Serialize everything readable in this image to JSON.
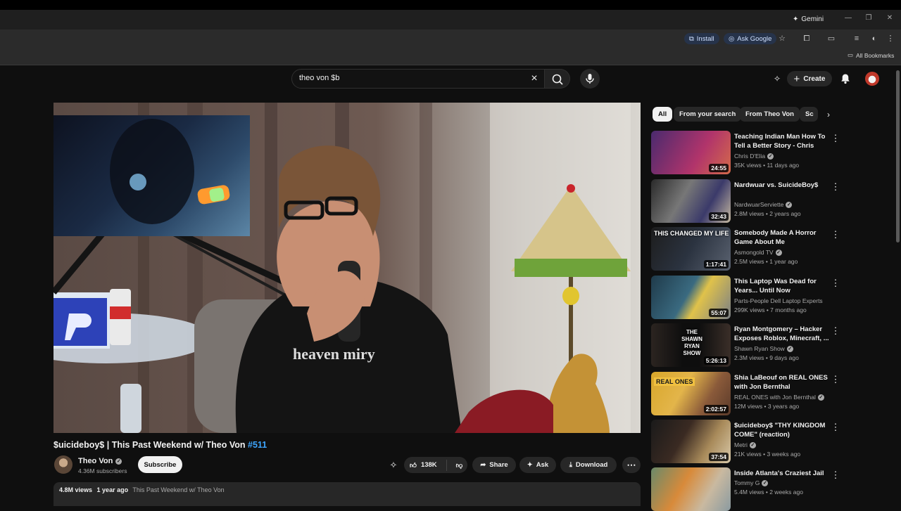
{
  "browser": {
    "gemini_label": "Gemini",
    "install_label": "Install",
    "ask_google_label": "Ask Google",
    "all_bookmarks_label": "All Bookmarks"
  },
  "youtube": {
    "search": {
      "value": "theo von $b"
    },
    "create_label": "Create"
  },
  "video": {
    "title_main": "$uicideboy$ | This Past Weekend w/ Theo Von",
    "title_tag": "#511",
    "channel": "Theo Von",
    "subscribers": "4.36M subscribers",
    "subscribe_label": "Subscribe",
    "likes": "138K",
    "share_label": "Share",
    "ask_label": "Ask",
    "download_label": "Download",
    "views": "4.8M views",
    "age": "1 year ago",
    "description_preview": "This Past Weekend w/ Theo Von"
  },
  "chips": [
    "All",
    "From your search",
    "From Theo Von",
    "Sc"
  ],
  "recommendations": [
    {
      "title": "Teaching Indian Man How To Tell a Better Story - Chris D'Eli...",
      "channel": "Chris D'Elia",
      "verified": true,
      "meta": "35K views • 11 days ago",
      "duration": "24:55",
      "thumb_text": ""
    },
    {
      "title": "Nardwuar vs. SuicideBoy$",
      "channel": "NardwuarServiette",
      "verified": true,
      "meta": "2.8M views • 2 years ago",
      "duration": "32:43",
      "thumb_text": ""
    },
    {
      "title": "Somebody Made A Horror Game About Me",
      "channel": "Asmongold TV",
      "verified": true,
      "meta": "2.5M views • 1 year ago",
      "duration": "1:17:41",
      "thumb_text": "THIS CHANGED MY LIFE"
    },
    {
      "title": "This Laptop Was Dead for Years... Until Now",
      "channel": "Parts-People Dell Laptop Experts",
      "verified": false,
      "meta": "299K views • 7 months ago",
      "duration": "55:07",
      "thumb_text": ""
    },
    {
      "title": "Ryan Montgomery – Hacker Exposes Roblox, Minecraft, ...",
      "channel": "Shawn Ryan Show",
      "verified": true,
      "meta": "2.3M views • 9 days ago",
      "duration": "5:26:13",
      "thumb_text": "THE SHAWN RYAN SHOW"
    },
    {
      "title": "Shia LaBeouf on REAL ONES with Jon Bernthal",
      "channel": "REAL ONES with Jon Bernthal",
      "verified": true,
      "meta": "12M views • 3 years ago",
      "duration": "2:02:57",
      "thumb_text": "REAL ONES"
    },
    {
      "title": "$uicideboy$ \"THY KINGDOM COME\" (reaction)",
      "channel": "Metri",
      "verified": true,
      "meta": "21K views • 3 weeks ago",
      "duration": "37:54",
      "thumb_text": ""
    },
    {
      "title": "Inside Atlanta's Craziest Jail",
      "channel": "Tommy G",
      "verified": true,
      "meta": "5.4M views • 2 weeks ago",
      "duration": "",
      "thumb_text": ""
    }
  ],
  "colors": {
    "accent_link": "#3ea6ff",
    "background": "#0f0f0f",
    "chip_bg": "#272727"
  }
}
